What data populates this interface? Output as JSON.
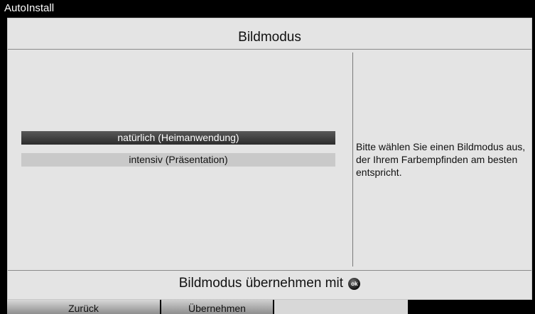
{
  "window": {
    "title": "AutoInstall"
  },
  "dialog": {
    "title": "Bildmodus",
    "options": [
      {
        "label": "natürlich (Heimanwendung)",
        "selected": true
      },
      {
        "label": "intensiv (Präsentation)",
        "selected": false
      }
    ],
    "help_text": "Bitte wählen Sie einen Bildmodus aus, der Ihrem Farbempfinden am besten entspricht.",
    "confirm_hint": "Bildmodus übernehmen mit",
    "confirm_icon": "ok-button-icon",
    "ok_glyph": "ok"
  },
  "softkeys": [
    {
      "label": "Zurück",
      "color": "red"
    },
    {
      "label": "Übernehmen",
      "color": "green"
    },
    {
      "label": "",
      "color": "yellow"
    },
    {
      "label": "",
      "color": "blue"
    }
  ]
}
